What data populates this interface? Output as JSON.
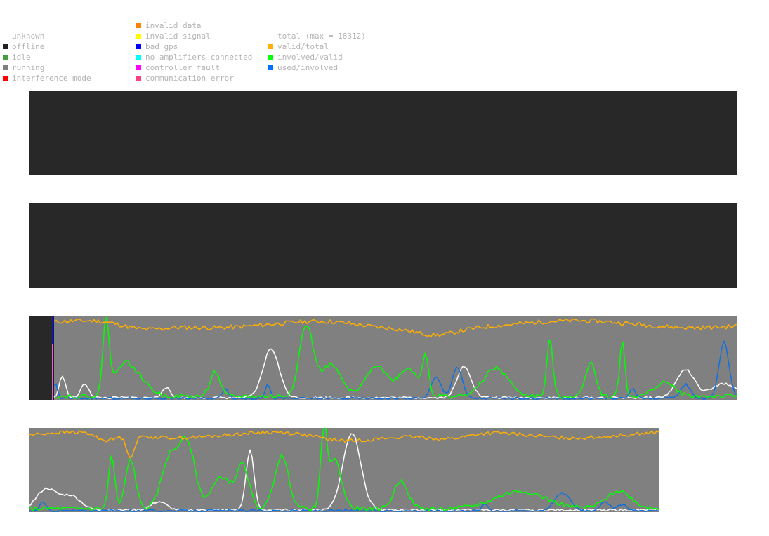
{
  "legend": {
    "status": [
      {
        "label": "unknown",
        "color": null,
        "icon": "none"
      },
      {
        "label": "offline",
        "color": "#202020",
        "icon": "square-swatch"
      },
      {
        "label": "idle",
        "color": "#40a040",
        "icon": "square-swatch"
      },
      {
        "label": "running",
        "color": "#808080",
        "icon": "square-swatch"
      },
      {
        "label": "interference mode",
        "color": "#ff0000",
        "icon": "square-swatch"
      }
    ],
    "errors": [
      {
        "label": "invalid data",
        "color": "#ff8000",
        "icon": "square-swatch"
      },
      {
        "label": "invalid signal",
        "color": "#ffff00",
        "icon": "square-swatch"
      },
      {
        "label": "bad gps",
        "color": "#0000ff",
        "icon": "square-swatch"
      },
      {
        "label": "no amplifiers connected",
        "color": "#00ffff",
        "icon": "square-swatch"
      },
      {
        "label": "controller fault",
        "color": "#ff00ff",
        "icon": "square-swatch"
      },
      {
        "label": "communication error",
        "color": "#ff4080",
        "icon": "square-swatch"
      }
    ],
    "ratios": [
      {
        "label": "total (max = 18312)",
        "color": null,
        "icon": "none"
      },
      {
        "label": "valid/total",
        "color": "#ffb000",
        "icon": "square-swatch"
      },
      {
        "label": "involved/valid",
        "color": "#00ff00",
        "icon": "square-swatch"
      },
      {
        "label": "used/involved",
        "color": "#0070ff",
        "icon": "square-swatch"
      }
    ]
  },
  "colors": {
    "offline_bg": "#282828",
    "running_bg": "#808080",
    "valid_total": "#ffb000",
    "involved_valid": "#00ff00",
    "used_involved": "#1070e0",
    "total": "#ffffff",
    "bad_gps": "#0000ff",
    "invalid_data": "#ff8000"
  },
  "panels": [
    {
      "state": "offline"
    },
    {
      "state": "offline"
    },
    {
      "state": "mixed",
      "offline_fraction": 0.035
    },
    {
      "state": "running",
      "width_fraction": 0.89
    }
  ]
}
